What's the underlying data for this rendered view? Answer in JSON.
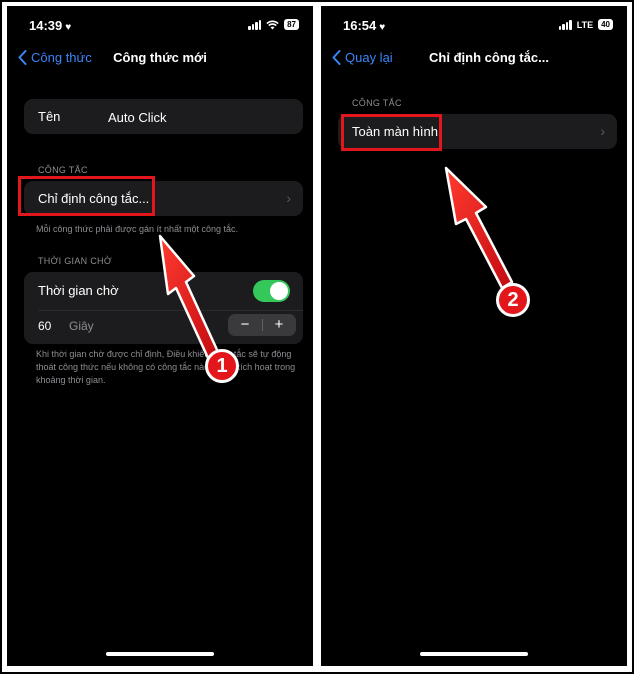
{
  "left": {
    "status": {
      "time": "14:39",
      "battery": "87"
    },
    "nav": {
      "back_label": "Công thức",
      "title": "Công thức mới"
    },
    "name_row": {
      "label": "Tên",
      "value": "Auto Click"
    },
    "switch_section": {
      "header": "CÔNG TẮC",
      "row_label": "Chỉ định công tắc...",
      "footer": "Mỗi công thức phải được gán ít nhất một công tắc."
    },
    "timeout_section": {
      "header": "THỜI GIAN CHỜ",
      "toggle_label": "Thời gian chờ",
      "toggle_on": true,
      "value": "60",
      "unit": "Giây",
      "minus": "−",
      "plus": "+",
      "footer": "Khi thời gian chờ được chỉ định, Điều khiển công tắc sẽ tự động thoát công thức nếu không có công tắc nào được kích hoạt trong khoảng thời gian."
    },
    "badge": "1"
  },
  "right": {
    "status": {
      "time": "16:54",
      "network": "LTE",
      "battery": "40"
    },
    "nav": {
      "back_label": "Quay lại",
      "title": "Chỉ định công tắc..."
    },
    "section": {
      "header": "CÔNG TẮC",
      "row_label": "Toàn màn hình"
    },
    "badge": "2"
  },
  "colors": {
    "accent": "#3a86f7",
    "highlight": "#e3161c",
    "toggle_on": "#34c759",
    "card": "#1c1c1e"
  }
}
